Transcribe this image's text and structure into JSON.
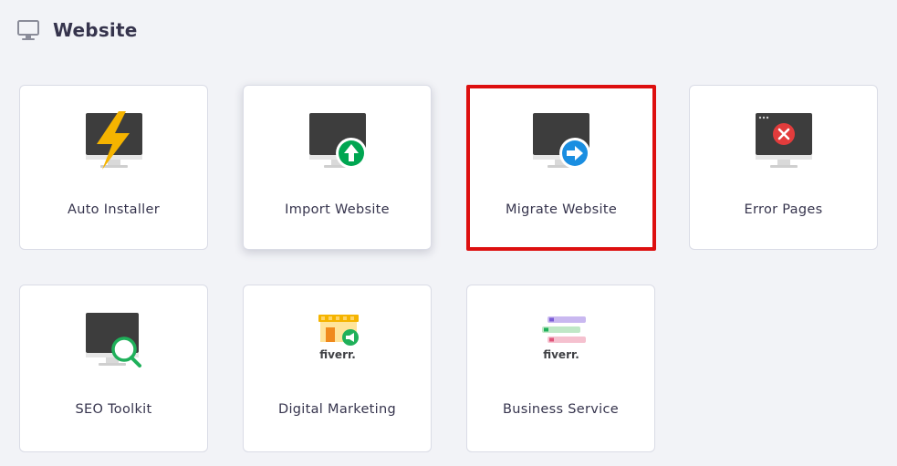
{
  "section": {
    "title": "Website",
    "icon": "monitor-icon"
  },
  "cards": [
    {
      "label": "Auto Installer",
      "icon": "monitor-lightning-icon"
    },
    {
      "label": "Import Website",
      "icon": "monitor-upload-icon"
    },
    {
      "label": "Migrate Website",
      "icon": "monitor-arrow-right-icon",
      "selected": true
    },
    {
      "label": "Error Pages",
      "icon": "monitor-error-icon"
    },
    {
      "label": "SEO Toolkit",
      "icon": "monitor-search-icon"
    },
    {
      "label": "Digital Marketing",
      "icon": "fiverr-storefront-icon",
      "logo_text": "fiverr."
    },
    {
      "label": "Business Service",
      "icon": "fiverr-list-icon",
      "logo_text": "fiverr."
    }
  ],
  "colors": {
    "background": "#f2f3f7",
    "card": "#ffffff",
    "text": "#36344d",
    "selected_outline": "#dd0f0f",
    "monitor": "#3d3d3d",
    "lightning": "#f5b400",
    "upload_green": "#00a651",
    "arrow_blue": "#1a8ee1",
    "error_red": "#e23c3c",
    "seo_green": "#1fb05a",
    "fiverr_green": "#1dbf73"
  }
}
